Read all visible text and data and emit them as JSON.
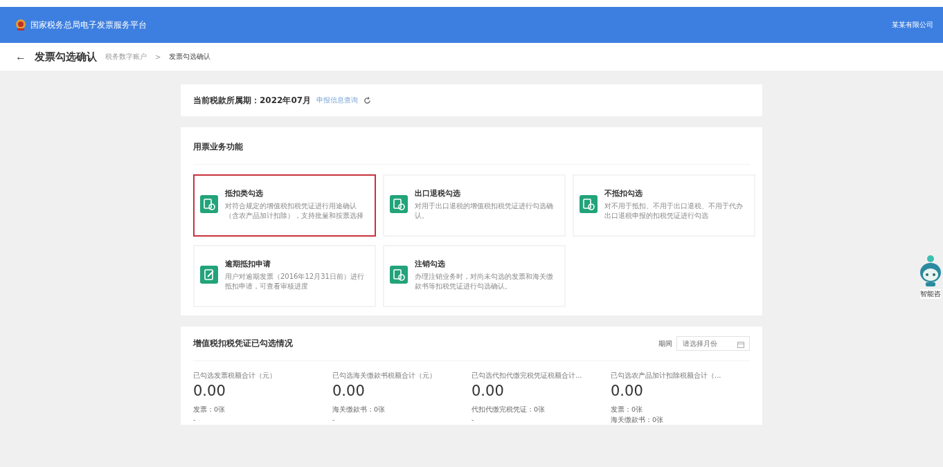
{
  "header": {
    "title": "国家税务总局电子发票服务平台",
    "user": "某某有限公司"
  },
  "subheader": {
    "back": "←",
    "title": "发票勾选确认",
    "breadcrumb": [
      "税务数字账户",
      "发票勾选确认"
    ],
    "separator": ">"
  },
  "period": {
    "label": "当前税款所属期：2022年07月",
    "link": "申报信息查询"
  },
  "functions": {
    "title": "用票业务功能",
    "items": [
      {
        "title": "抵扣类勾选",
        "desc": "对符合规定的增值税扣税凭证进行用途确认（含农产品加计扣除），支持批量和按票选择",
        "selected": true,
        "kind": "doc"
      },
      {
        "title": "出口退税勾选",
        "desc": "对用于出口退税的增值税扣税凭证进行勾选确认。",
        "selected": false,
        "kind": "doc"
      },
      {
        "title": "不抵扣勾选",
        "desc": "对不用于抵扣、不用于出口退税、不用于代办出口退税申报的扣税凭证进行勾选",
        "selected": false,
        "kind": "doc"
      },
      {
        "title": "逾期抵扣申请",
        "desc": "用户对逾期发票（2016年12月31日前）进行抵扣申请，可查看审核进度",
        "selected": false,
        "kind": "edit"
      },
      {
        "title": "注销勾选",
        "desc": "办理注销业务时，对尚未勾选的发票和海关缴款书等扣税凭证进行勾选确认。",
        "selected": false,
        "kind": "doc"
      }
    ]
  },
  "summary": {
    "title": "增值税扣税凭证已勾选情况",
    "period_label": "期间",
    "period_placeholder": "请选择月份",
    "columns": [
      {
        "label": "已勾选发票税额合计（元）",
        "value": "0.00",
        "lines": [
          "发票：0张",
          "-"
        ]
      },
      {
        "label": "已勾选海关缴款书税额合计（元）",
        "value": "0.00",
        "lines": [
          "海关缴款书：0张",
          "-"
        ]
      },
      {
        "label": "已勾选代扣代缴完税凭证税额合计...",
        "value": "0.00",
        "lines": [
          "代扣代缴完税凭证：0张",
          "-"
        ]
      },
      {
        "label": "已勾选农产品加计扣除税额合计（...",
        "value": "0.00",
        "lines": [
          "发票：0张",
          "海关缴款书：0张"
        ]
      }
    ]
  },
  "assistant": {
    "label": "智能咨"
  }
}
